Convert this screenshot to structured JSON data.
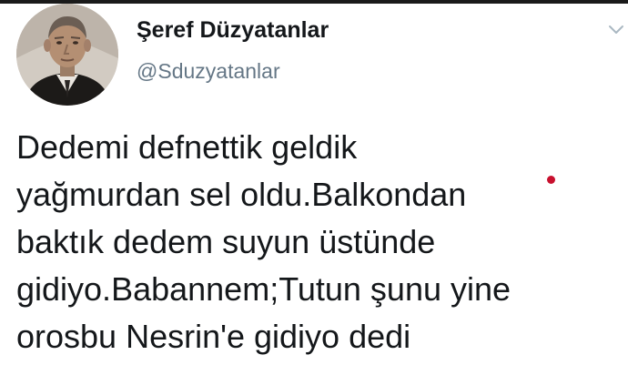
{
  "author": {
    "display_name": "Şeref Düzyatanlar",
    "handle": "@Sduzyatanlar",
    "avatar_icon": "profile-photo-elderly-man"
  },
  "tweet": {
    "lines": [
      "Dedemi defnettik geldik",
      "yağmurdan sel oldu.Balkondan",
      "baktık dedem suyun üstünde",
      "gidiyo.Babannem;Tutun şunu yine",
      "orosbu Nesrin'e gidiyo dedi"
    ]
  },
  "menu_icon": "chevron-down-icon",
  "colors": {
    "text": "#14171a",
    "secondary": "#657786",
    "background": "#ffffff"
  }
}
